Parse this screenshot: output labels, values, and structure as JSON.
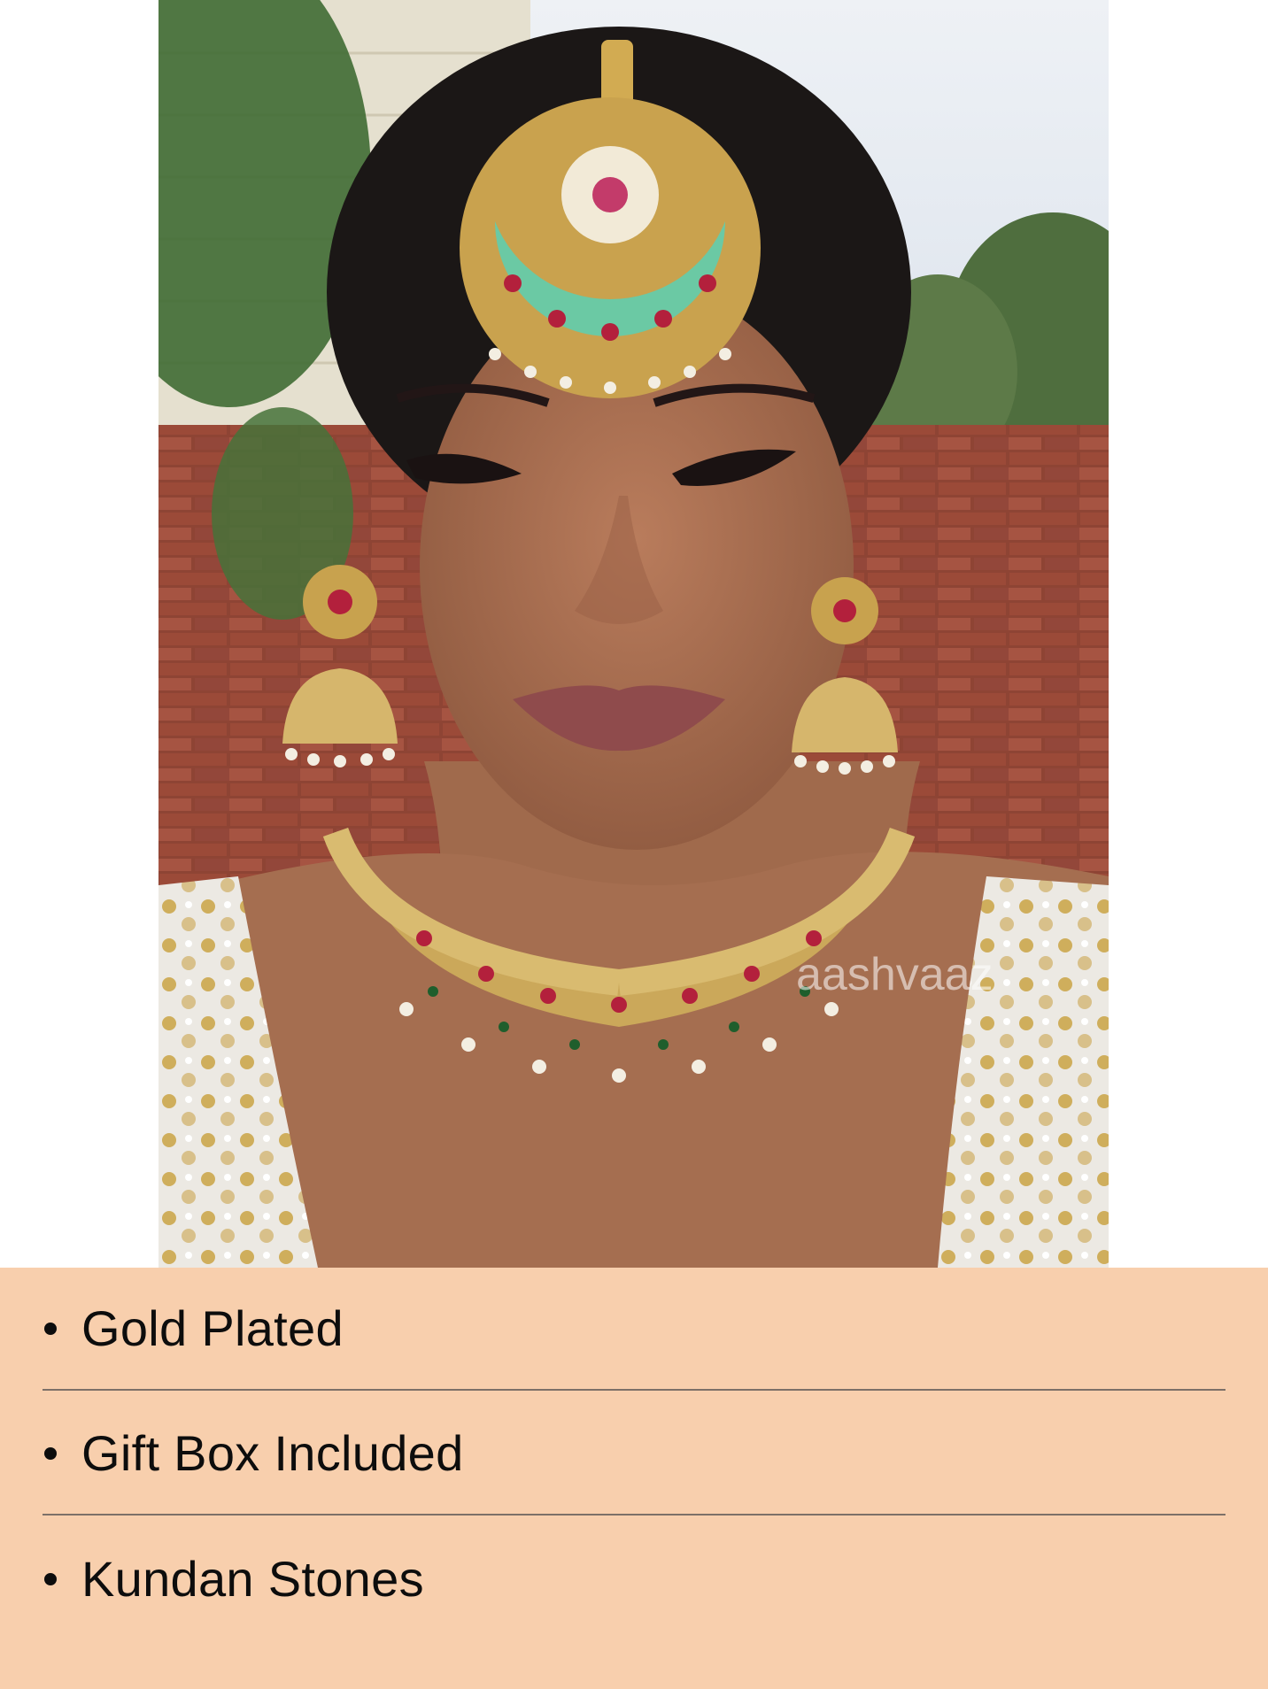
{
  "photo": {
    "subject": "woman wearing gold kundan maang tikka, jhumka earrings and choker necklace",
    "watermark": "aashvaaz"
  },
  "features": {
    "items": [
      {
        "label": "Gold Plated"
      },
      {
        "label": "Gift Box Included"
      },
      {
        "label": "Kundan Stones"
      }
    ]
  },
  "colors": {
    "panel_background": "#f8cfad",
    "divider": "#7d7068",
    "text": "#0d0d0d"
  }
}
